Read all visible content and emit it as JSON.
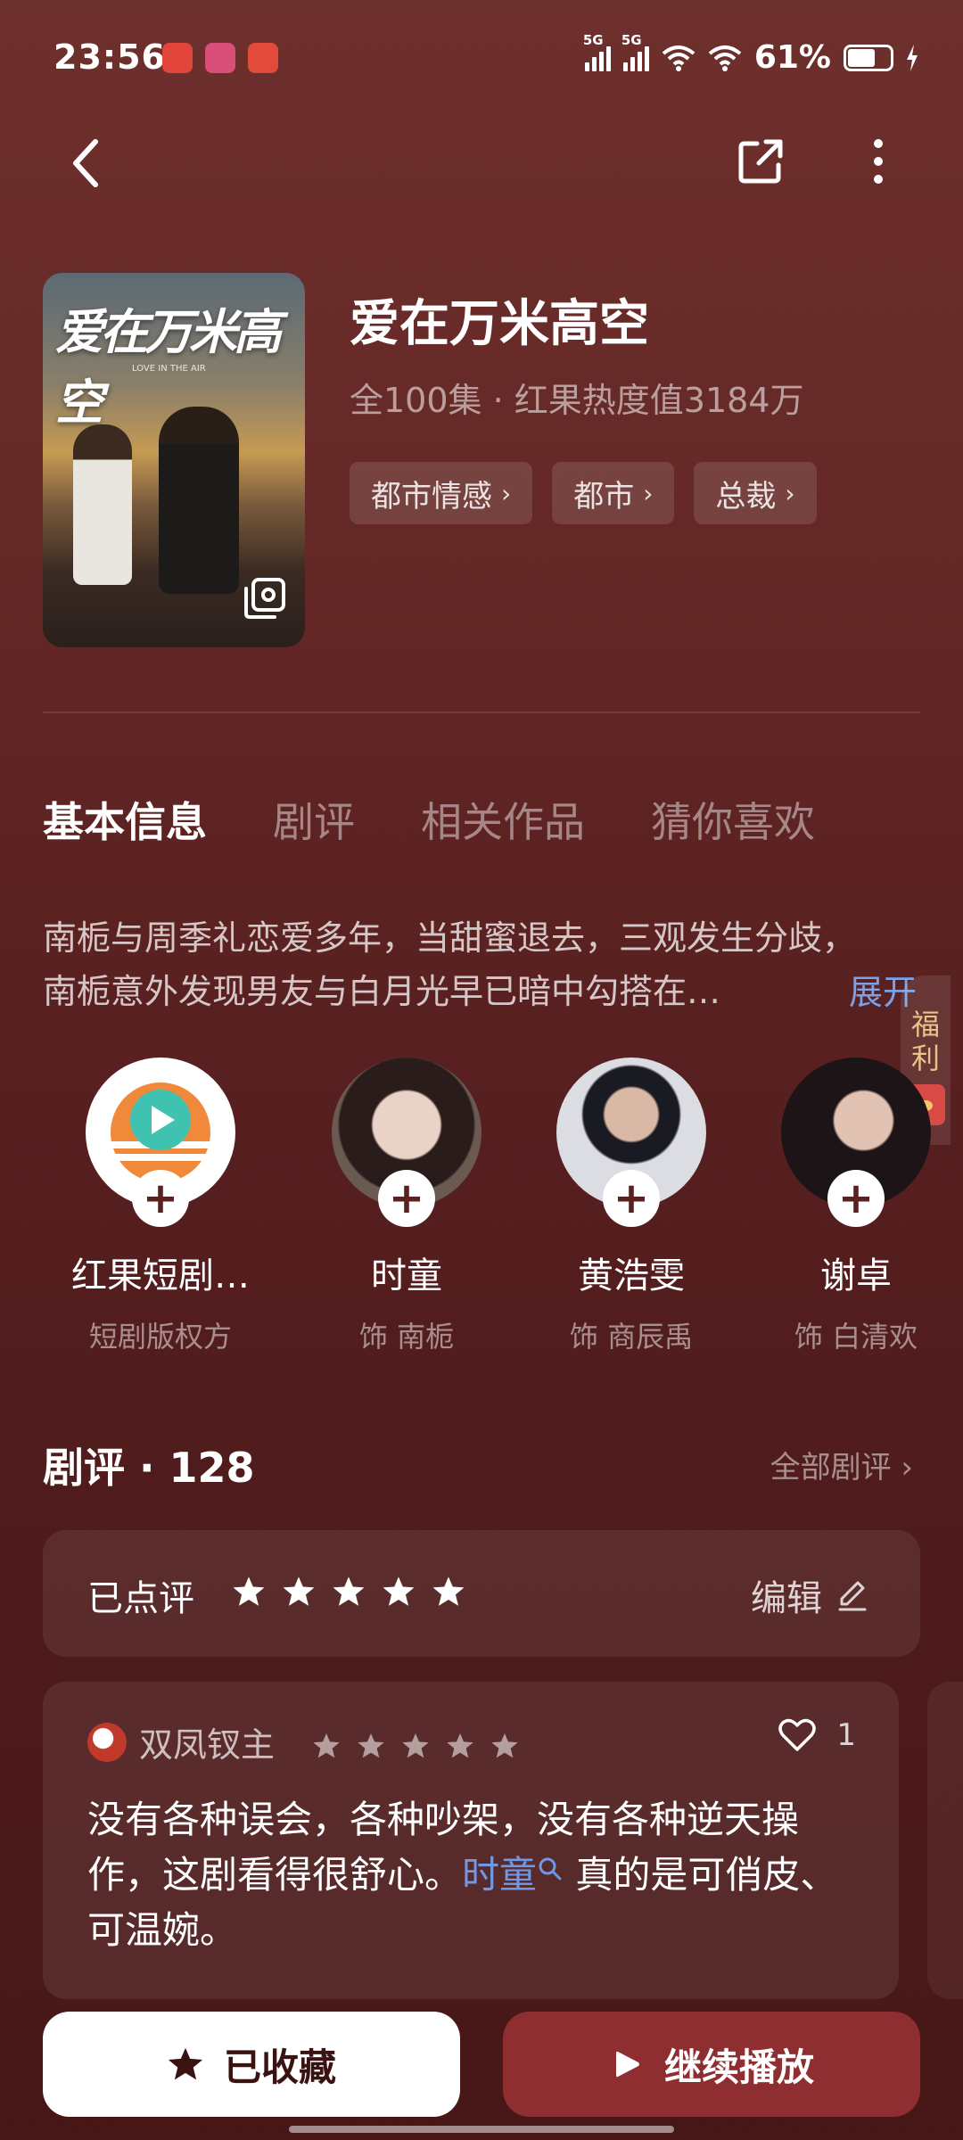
{
  "status_bar": {
    "time": "23:56",
    "network_1": "5G",
    "network_2": "5G",
    "battery": "61%",
    "app_icon_colors": [
      "#e2453c",
      "#d94f7a",
      "#e24a3a"
    ]
  },
  "nav": {
    "back_icon": "chevron-left-icon",
    "share_icon": "share-icon",
    "more_icon": "more-vertical-icon"
  },
  "drama": {
    "title": "爱在万米高空",
    "meta": "全100集 · 红果热度值3184万",
    "cover_title": "爱在万米高空",
    "cover_subtitle": "LOVE IN THE AIR",
    "tags": [
      "都市情感",
      "都市",
      "总裁"
    ]
  },
  "tabs": [
    "基本信息",
    "剧评",
    "相关作品",
    "猜你喜欢"
  ],
  "synopsis": {
    "line1": "南栀与周季礼恋爱多年，当甜蜜退去，三观发生分歧，",
    "line2": "南栀意外发现男友与白月光早已暗中勾搭在…",
    "expand": "展开"
  },
  "fuli": {
    "line1": "福",
    "line2": "利"
  },
  "cast": [
    {
      "name": "红果短剧…",
      "role": "短剧版权方"
    },
    {
      "name": "时童",
      "role": "饰 南栀"
    },
    {
      "name": "黄浩雯",
      "role": "饰 商辰禹"
    },
    {
      "name": "谢卓",
      "role": "饰 白清欢"
    }
  ],
  "reviews": {
    "header": "剧评 · 128",
    "all_link": "全部剧评",
    "rated_label": "已点评",
    "my_rating": 5,
    "edit_label": "编辑",
    "item": {
      "user": "双凤钗主",
      "rating": 5,
      "likes": "1",
      "text_before": "没有各种误会，各种吵架，没有各种逆天操作，这剧看得很舒心。",
      "mention": "时童",
      "text_after": "真的是可俏皮、可温婉。"
    }
  },
  "bottom": {
    "fav_label": "已收藏",
    "play_label": "继续播放"
  },
  "colors": {
    "accent_blue": "#6f98e6",
    "play_button": "#8e2e30",
    "background_top": "#6e302d",
    "background_bottom": "#471718"
  }
}
